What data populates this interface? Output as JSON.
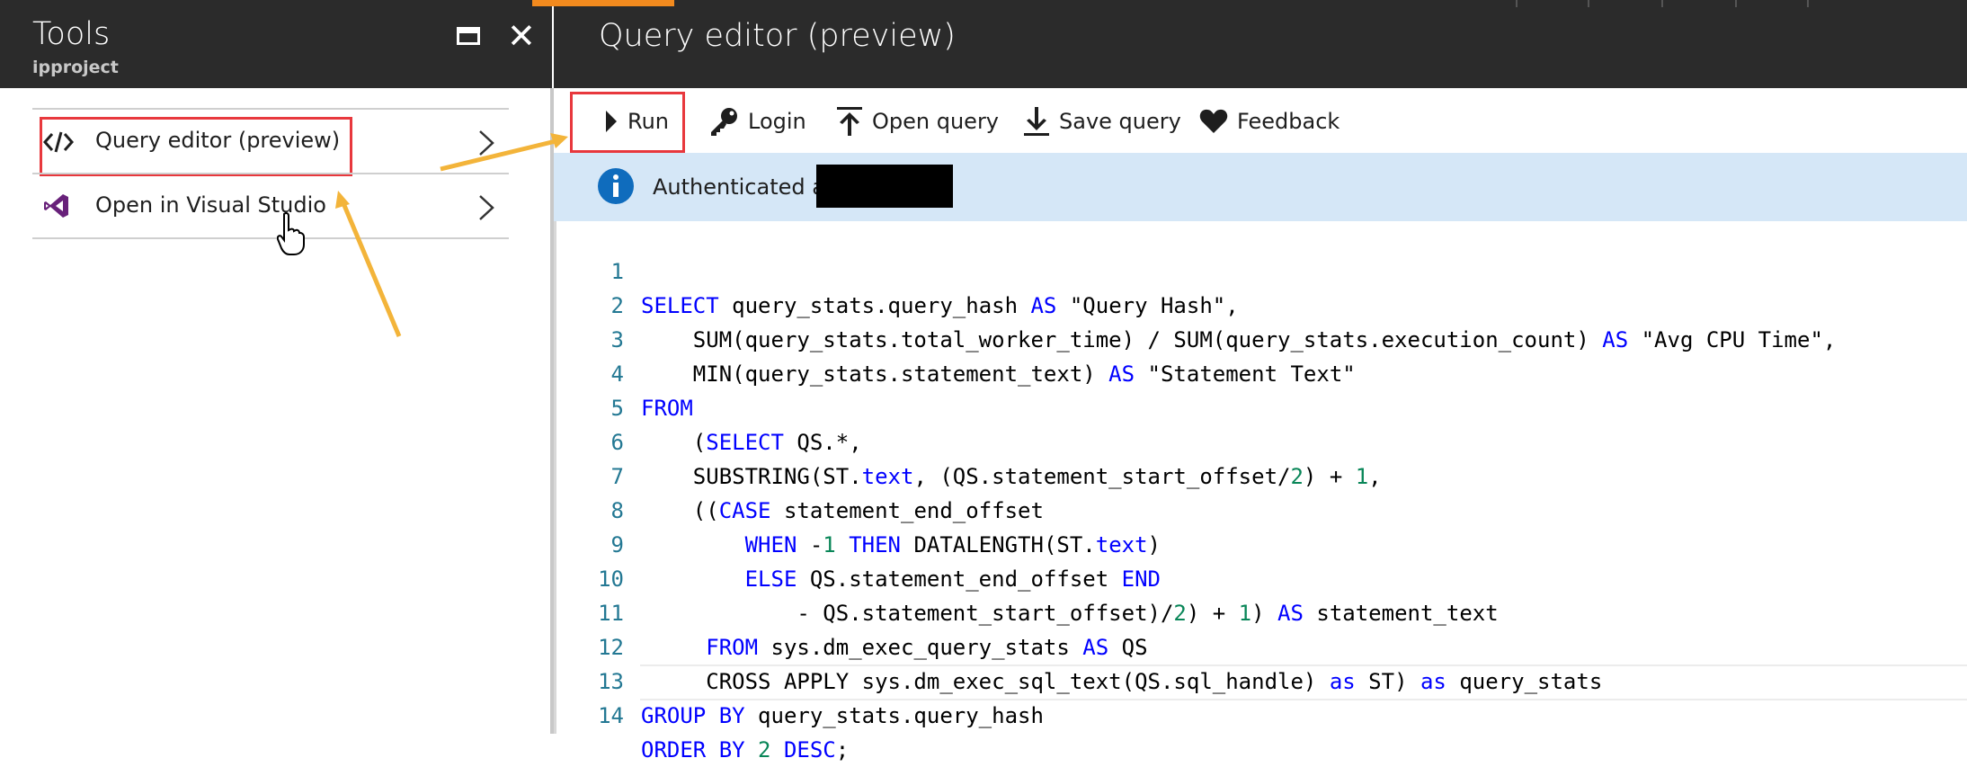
{
  "left_panel": {
    "title": "Tools",
    "subtitle": "ipproject",
    "items": [
      {
        "label": "Query editor (preview)",
        "icon": "code-icon"
      },
      {
        "label": "Open in Visual Studio",
        "icon": "visual-studio-icon"
      }
    ]
  },
  "editor_panel": {
    "title": "Query editor (preview)",
    "toolbar": {
      "run": "Run",
      "login": "Login",
      "open_query": "Open query",
      "save_query": "Save query",
      "feedback": "Feedback"
    },
    "auth_message": "Authenticated as"
  },
  "code_lines": [
    "1",
    "2",
    "3",
    "4",
    "5",
    "6",
    "7",
    "8",
    "9",
    "10",
    "11",
    "12",
    "13",
    "14"
  ],
  "colors": {
    "keyword": "#0000ff",
    "number": "#098658",
    "line_number": "#237893",
    "highlight": "#e8383d",
    "arrow": "#f3b43a",
    "accent": "#f28a1e"
  }
}
